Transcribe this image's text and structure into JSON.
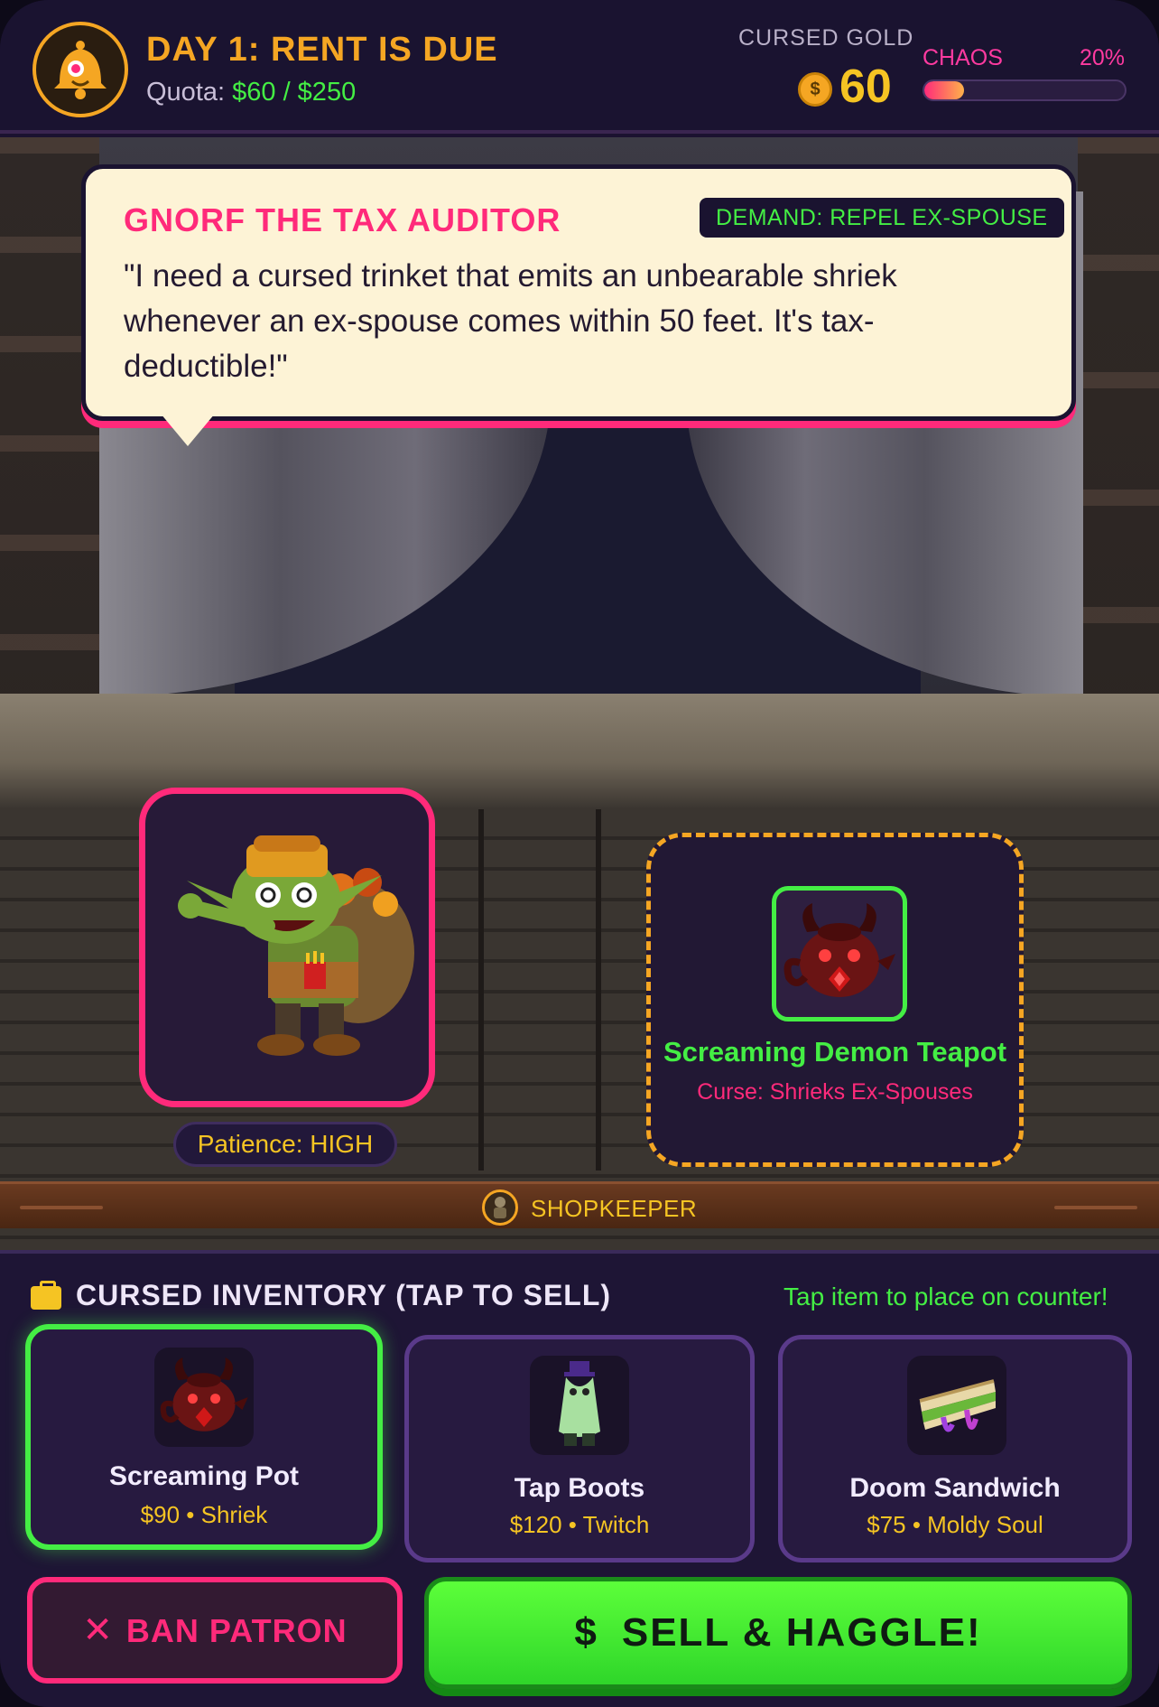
{
  "header": {
    "day_title": "DAY 1: RENT IS DUE",
    "quota_label": "Quota:",
    "quota_value": "$60 / $250",
    "gold_label": "CURSED GOLD",
    "gold_coin_symbol": "$",
    "gold_value": "60",
    "chaos_label": "CHAOS",
    "chaos_percent": "20%",
    "chaos_fraction": 0.2
  },
  "patron": {
    "name": "GNORF THE TAX AUDITOR",
    "demand": "DEMAND: REPEL EX-SPOUSE",
    "quote": "\"I need a cursed trinket that emits an unbearable shriek whenever an ex-spouse comes within 50 feet. It's tax-deductible!\"",
    "patience": "Patience: HIGH"
  },
  "counter_slot": {
    "item_name": "Screaming Demon Teapot",
    "curse": "Curse: Shrieks Ex-Spouses"
  },
  "shopkeeper_label": "SHOPKEEPER",
  "inventory": {
    "title": "CURSED INVENTORY (TAP TO SELL)",
    "hint": "Tap item to place on counter!",
    "items": [
      {
        "name": "Screaming Pot",
        "meta": "$90 • Shriek",
        "icon": "demon-teapot-icon"
      },
      {
        "name": "Tap Boots",
        "meta": "$120 • Twitch",
        "icon": "tap-boots-icon"
      },
      {
        "name": "Doom Sandwich",
        "meta": "$75 • Moldy Soul",
        "icon": "doom-sandwich-icon"
      }
    ]
  },
  "buttons": {
    "ban_icon": "✕",
    "ban_label": "BAN PATRON",
    "sell_icon": "$",
    "sell_label": "SELL & HAGGLE!"
  },
  "colors": {
    "accent_pink": "#ff2a7a",
    "accent_green": "#44ee44",
    "accent_gold": "#f5a623",
    "panel": "#1e1535"
  }
}
